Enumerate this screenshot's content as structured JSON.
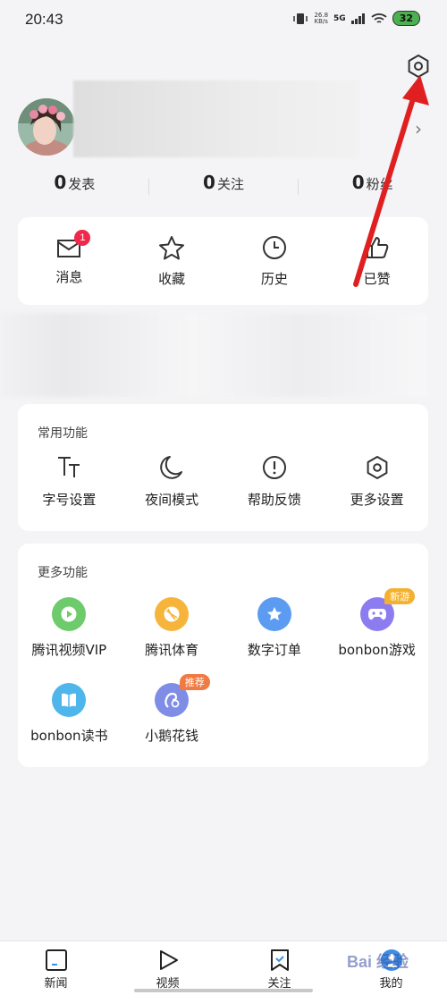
{
  "status_bar": {
    "time": "20:43",
    "net_speed_value": "26.8",
    "net_speed_unit": "KB/s",
    "network": "5G",
    "battery": "32"
  },
  "profile": {
    "stats": [
      {
        "count": "0",
        "label": "发表"
      },
      {
        "count": "0",
        "label": "关注"
      },
      {
        "count": "0",
        "label": "粉丝"
      }
    ]
  },
  "quick_actions": [
    {
      "label": "消息",
      "icon": "mail-icon",
      "badge": "1"
    },
    {
      "label": "收藏",
      "icon": "star-icon"
    },
    {
      "label": "历史",
      "icon": "clock-icon"
    },
    {
      "label": "已赞",
      "icon": "thumbs-up-icon"
    }
  ],
  "common_functions": {
    "title": "常用功能",
    "items": [
      {
        "label": "字号设置",
        "icon": "font-size-icon"
      },
      {
        "label": "夜间模式",
        "icon": "moon-icon"
      },
      {
        "label": "帮助反馈",
        "icon": "exclamation-circle-icon"
      },
      {
        "label": "更多设置",
        "icon": "hexagon-settings-icon"
      }
    ]
  },
  "more_functions": {
    "title": "更多功能",
    "items": [
      {
        "label": "腾讯视频VIP",
        "icon": "play-icon",
        "color": "#6dcb6b"
      },
      {
        "label": "腾讯体育",
        "icon": "ball-icon",
        "color": "#f6b43a"
      },
      {
        "label": "数字订单",
        "icon": "star-badge-icon",
        "color": "#5b9cf2"
      },
      {
        "label": "bonbon游戏",
        "icon": "gamepad-icon",
        "color": "#8d7cf0",
        "tag": "新游",
        "tag_color": "#f4b12d"
      },
      {
        "label": "bonbon读书",
        "icon": "book-icon",
        "color": "#4eb6ea"
      },
      {
        "label": "小鹅花钱",
        "icon": "wallet-icon",
        "color": "#7f8de6",
        "tag": "推荐",
        "tag_color": "#f07a42"
      }
    ]
  },
  "bottom_nav": [
    {
      "label": "新闻",
      "icon": "news-icon"
    },
    {
      "label": "视频",
      "icon": "video-icon"
    },
    {
      "label": "关注",
      "icon": "bookmark-icon"
    },
    {
      "label": "我的",
      "icon": "profile-icon"
    }
  ],
  "watermark": "Bai 经验",
  "colors": {
    "badge": "#f0294a",
    "arrow": "#e02020",
    "battery": "#4caf50"
  }
}
